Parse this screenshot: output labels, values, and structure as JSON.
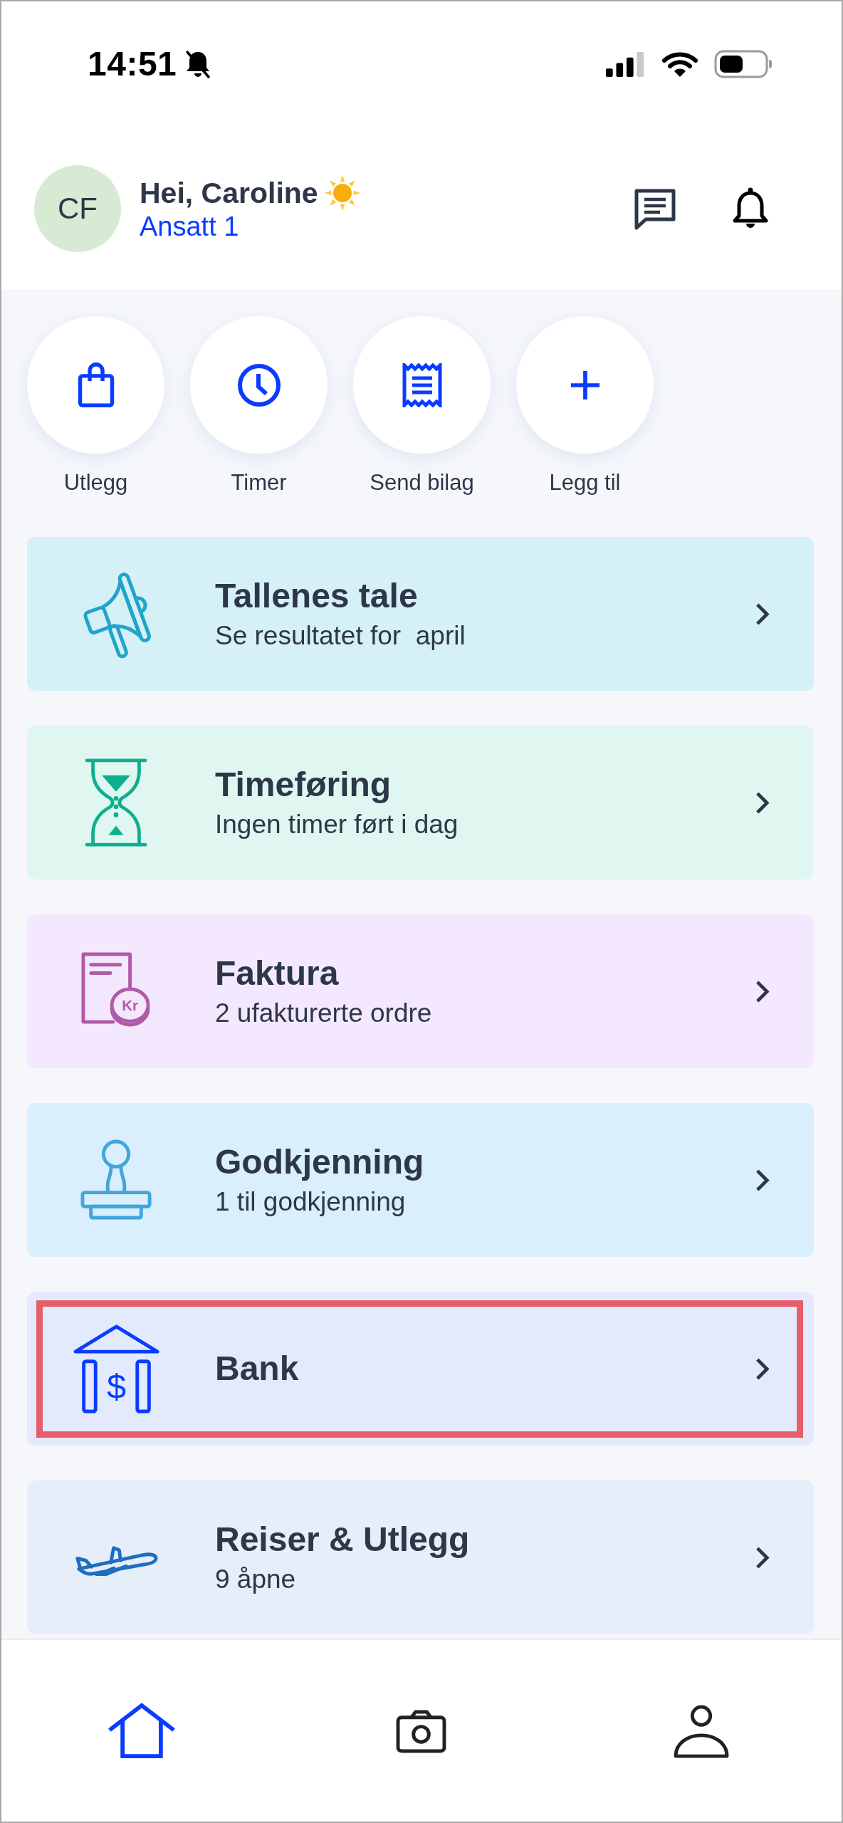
{
  "status_bar": {
    "time": "14:51"
  },
  "header": {
    "avatar_initials": "CF",
    "greeting": "Hei, Caroline",
    "role": "Ansatt 1"
  },
  "quick_actions": [
    {
      "label": "Utlegg"
    },
    {
      "label": "Timer"
    },
    {
      "label": "Send bilag"
    },
    {
      "label": "Legg til"
    }
  ],
  "cards": [
    {
      "title": "Tallenes tale",
      "subtitle": "Se resultatet for  april",
      "highlighted": false
    },
    {
      "title": "Timeføring",
      "subtitle": "Ingen timer ført i dag",
      "highlighted": false
    },
    {
      "title": "Faktura",
      "subtitle": "2 ufakturerte ordre",
      "icon_text": "Kr",
      "highlighted": false
    },
    {
      "title": "Godkjenning",
      "subtitle": "1 til godkjenning",
      "highlighted": false
    },
    {
      "title": "Bank",
      "icon_text": "$",
      "highlighted": true
    },
    {
      "title": "Reiser & Utlegg",
      "subtitle": "9 åpne",
      "highlighted": false
    }
  ],
  "bottom_nav": [
    {
      "selected": true
    },
    {
      "selected": false
    },
    {
      "selected": false
    }
  ]
}
